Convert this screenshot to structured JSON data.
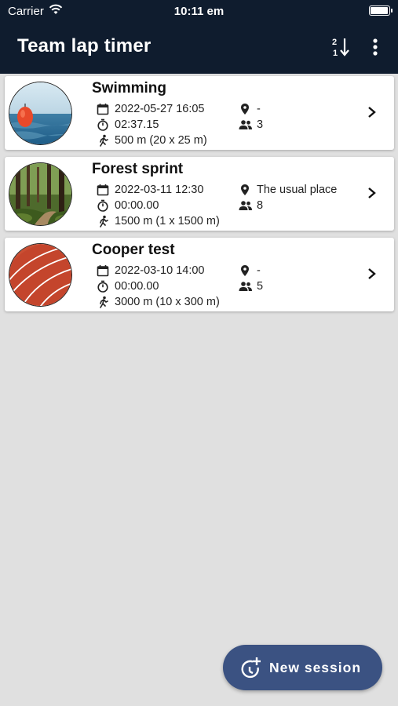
{
  "status_bar": {
    "carrier": "Carrier",
    "time": "10:11 em",
    "battery_level": 1.0
  },
  "app_bar": {
    "title": "Team lap timer",
    "actions": [
      "sort-numeric-icon",
      "more-vert-icon"
    ]
  },
  "sessions": [
    {
      "title": "Swimming",
      "image": "swimming-buoy-photo",
      "datetime": "2022-05-27 16:05",
      "duration": "02:37.15",
      "distance": "500 m (20 x 25 m)",
      "location": "-",
      "participants": "3"
    },
    {
      "title": "Forest sprint",
      "image": "forest-trail-photo",
      "datetime": "2022-03-11 12:30",
      "duration": "00:00.00",
      "distance": "1500 m (1 x 1500 m)",
      "location": "The usual place",
      "participants": "8"
    },
    {
      "title": "Cooper test",
      "image": "running-track-photo",
      "datetime": "2022-03-10 14:00",
      "duration": "00:00.00",
      "distance": "3000 m (10 x 300 m)",
      "location": "-",
      "participants": "5"
    }
  ],
  "fab": {
    "label": "New session",
    "icon": "timer-plus-icon"
  },
  "colors": {
    "app_bar": "#0f1c2e",
    "background": "#e0e0e0",
    "fab": "#3b5282"
  }
}
